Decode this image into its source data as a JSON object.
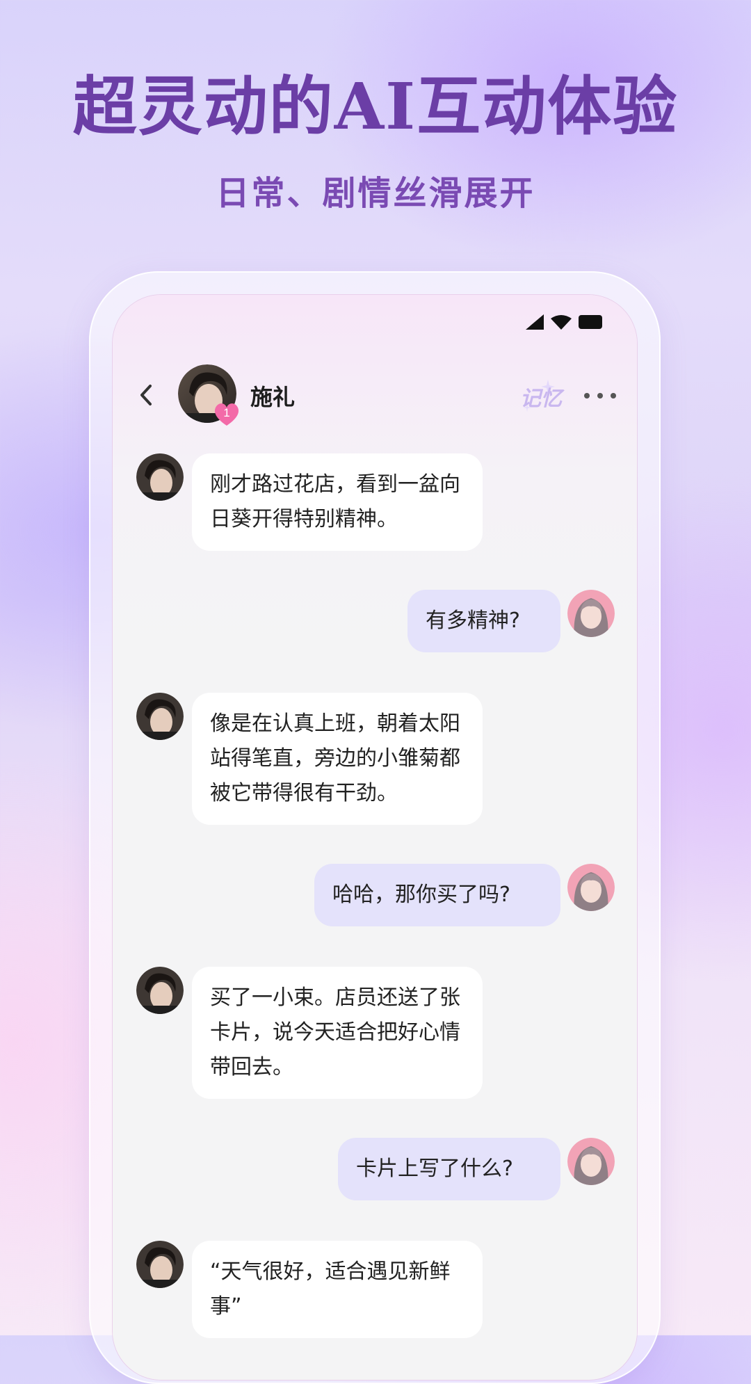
{
  "hero": {
    "title": "超灵动的AI互动体验",
    "subtitle": "日常、剧情丝滑展开"
  },
  "colors": {
    "title": "#6b3ea6",
    "incoming_bubble": "#ffffff",
    "outgoing_bubble": "#e4e2fb",
    "badge": "#f36aa8"
  },
  "status_bar": {
    "icons": [
      "signal-icon",
      "wifi-icon",
      "battery-icon"
    ]
  },
  "chat": {
    "contact_name": "施礼",
    "intimacy_badge": "1",
    "memory_label": "记忆",
    "messages": [
      {
        "from": "ai",
        "text": "刚才路过花店，看到一盆向日葵开得特别精神。"
      },
      {
        "from": "user",
        "text": "有多精神?"
      },
      {
        "from": "ai",
        "text": "像是在认真上班，朝着太阳站得笔直，旁边的小雏菊都被它带得很有干劲。"
      },
      {
        "from": "user",
        "text": "哈哈，那你买了吗?"
      },
      {
        "from": "ai",
        "text": "买了一小束。店员还送了张卡片，说今天适合把好心情带回去。"
      },
      {
        "from": "user",
        "text": "卡片上写了什么?"
      },
      {
        "from": "ai",
        "text": "“天气很好，适合遇见新鲜事”"
      }
    ]
  }
}
